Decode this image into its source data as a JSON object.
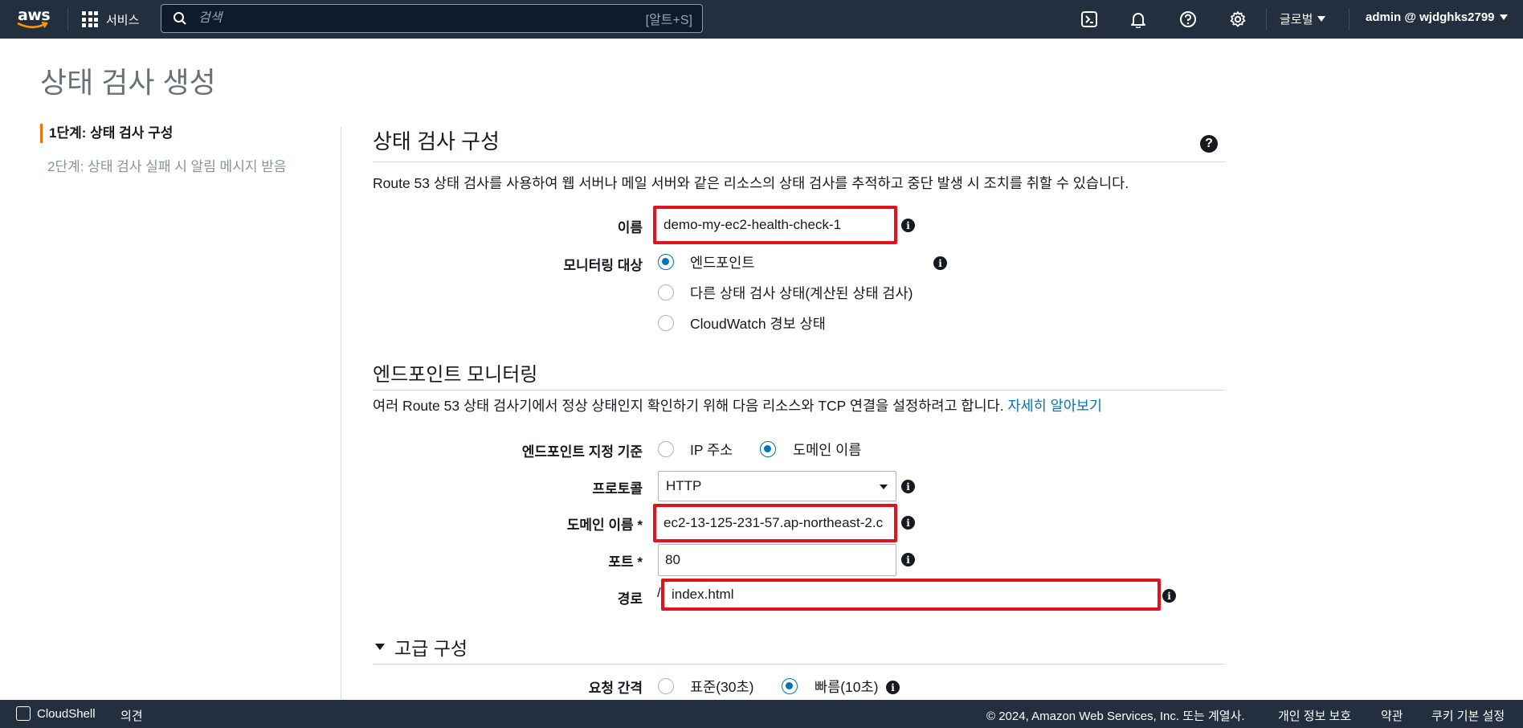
{
  "topnav": {
    "logo_text": "aws",
    "services_label": "서비스",
    "search_placeholder": "검색",
    "search_shortcut": "[알트+S]",
    "region_label": "글로벌",
    "account_label": "admin @ wjdghks2799",
    "icons": [
      "cloudshell-icon",
      "bell-icon",
      "help-icon",
      "gear-icon"
    ]
  },
  "page": {
    "title": "상태 검사 생성"
  },
  "steps": [
    {
      "label": "1단계: 상태 검사 구성",
      "active": true
    },
    {
      "label": "2단계: 상태 검사 실패 시 알림 메시지 받음",
      "active": false
    }
  ],
  "config": {
    "title": "상태 검사 구성",
    "help": "?",
    "description": "Route 53 상태 검사를 사용하여 웹 서버나 메일 서버와 같은 리소스의 상태 검사를 추적하고 중단 발생 시 조치를 취할 수 있습니다.",
    "name_label": "이름",
    "name_value": "demo-my-ec2-health-check-1",
    "monitor_label": "모니터링 대상",
    "monitor_options": [
      "엔드포인트",
      "다른 상태 검사 상태(계산된 상태 검사)",
      "CloudWatch 경보 상태"
    ],
    "monitor_selected": 0
  },
  "endpoint": {
    "title": "엔드포인트 모니터링",
    "description": "여러 Route 53 상태 검사기에서 정상 상태인지 확인하기 위해 다음 리소스와 TCP 연결을 설정하려고 합니다.",
    "learn_more": "자세히 알아보기",
    "specify_label": "엔드포인트 지정 기준",
    "specify_options": [
      "IP 주소",
      "도메인 이름"
    ],
    "specify_selected": 1,
    "protocol_label": "프로토콜",
    "protocol_value": "HTTP",
    "domain_label": "도메인 이름 *",
    "domain_value": "ec2-13-125-231-57.ap-northeast-2.c",
    "port_label": "포트 *",
    "port_value": "80",
    "path_label": "경로",
    "path_prefix": "/",
    "path_value": "index.html"
  },
  "advanced": {
    "title": "고급 구성",
    "interval_label": "요청 간격",
    "interval_options": [
      "표준(30초)",
      "빠름(10초)"
    ],
    "interval_selected": 1
  },
  "footer": {
    "cloudshell": "CloudShell",
    "feedback": "의견",
    "copyright": "© 2024, Amazon Web Services, Inc. 또는 계열사.",
    "privacy": "개인 정보 보호",
    "terms": "약관",
    "cookies": "쿠키 기본 설정"
  },
  "colors": {
    "nav_bg": "#232f3e",
    "highlight_red": "#e0141e",
    "link_blue": "#0073bb",
    "step_accent": "#ec7211"
  }
}
